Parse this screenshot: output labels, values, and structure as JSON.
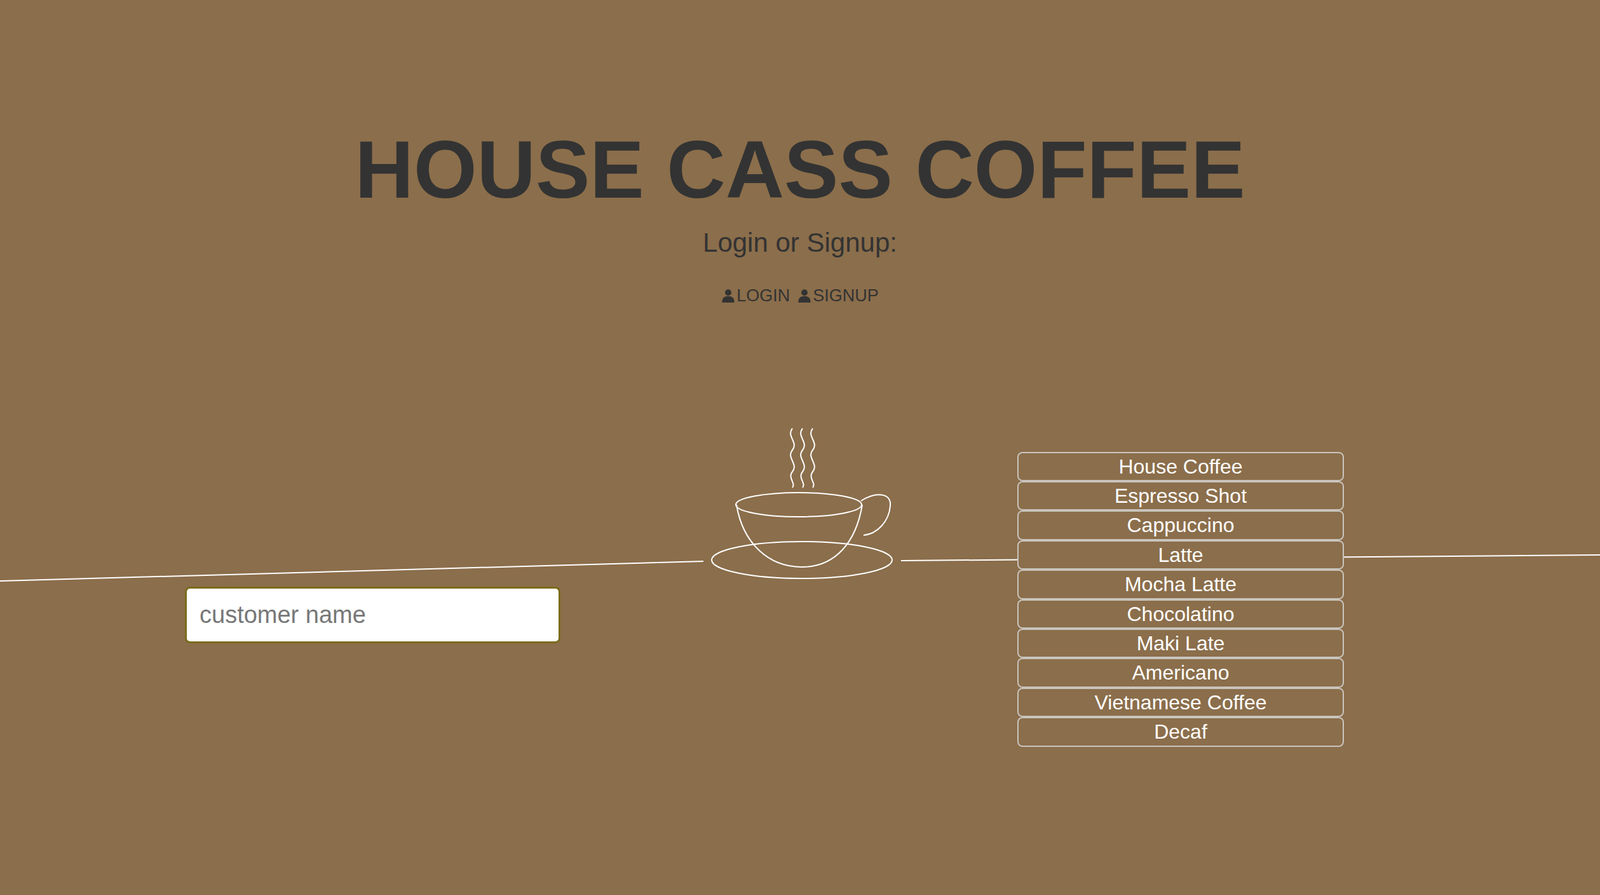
{
  "header": {
    "title": "HOUSE CASS COFFEE",
    "subtitle": "Login or Signup:",
    "links": [
      "LOGIN",
      "SIGNUP"
    ]
  },
  "order": {
    "placeholder": "customer name"
  },
  "menu": [
    "House Coffee",
    "Espresso Shot",
    "Cappuccino",
    "Latte",
    "Mocha Latte",
    "Chocolatino",
    "Maki Late",
    "Americano",
    "Vietnamese Coffee",
    "Decaf"
  ]
}
